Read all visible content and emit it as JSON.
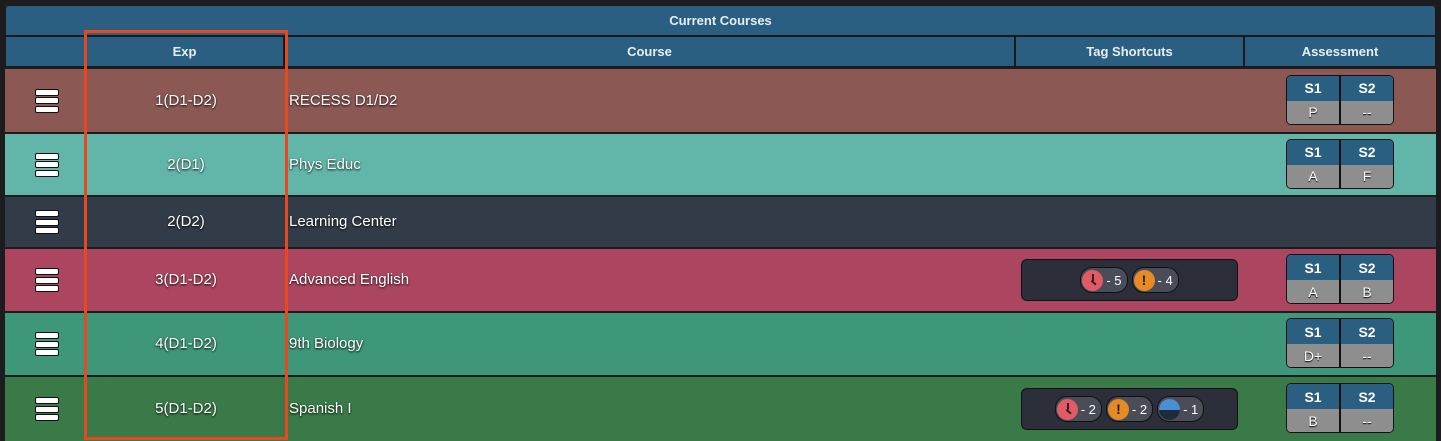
{
  "table_title": "Current Courses",
  "headers": {
    "exp": "Exp",
    "course": "Course",
    "tags": "Tag Shortcuts",
    "assessment": "Assessment"
  },
  "assessment_headers": {
    "s1": "S1",
    "s2": "S2"
  },
  "rows": [
    {
      "exp": "1(D1-D2)",
      "course": "RECESS D1/D2",
      "color": "#8c5854",
      "s1": "P",
      "s2": "--"
    },
    {
      "exp": "2(D1)",
      "course": "Phys Educ",
      "color": "#62b6a9",
      "s1": "A",
      "s2": "F"
    },
    {
      "exp": "2(D2)",
      "course": "Learning Center",
      "color": "#323c48"
    },
    {
      "exp": "3(D1-D2)",
      "course": "Advanced English",
      "color": "#ac4660",
      "s1": "A",
      "s2": "B",
      "tags": [
        {
          "icon": "clock-icon",
          "count": "- 5"
        },
        {
          "icon": "alert-icon",
          "count": "- 4"
        }
      ]
    },
    {
      "exp": "4(D1-D2)",
      "course": "9th Biology",
      "color": "#3e9779",
      "s1": "D+",
      "s2": "--"
    },
    {
      "exp": "5(D1-D2)",
      "course": "Spanish I",
      "color": "#3a7a49",
      "s1": "B",
      "s2": "--",
      "tags": [
        {
          "icon": "clock-icon",
          "count": "- 2"
        },
        {
          "icon": "alert-icon",
          "count": "- 2"
        },
        {
          "icon": "half-circle-icon",
          "count": "- 1"
        }
      ]
    }
  ]
}
